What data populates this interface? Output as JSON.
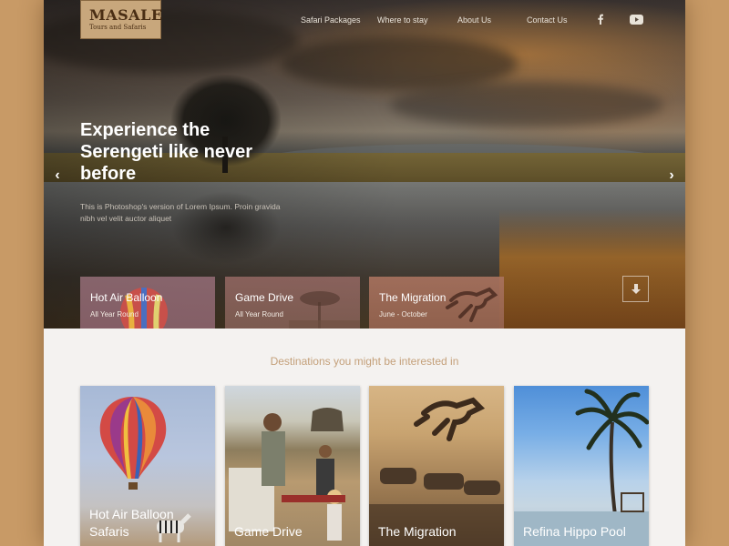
{
  "brand": {
    "name": "MASALE",
    "tagline": "Tours and Safaris"
  },
  "nav": {
    "items": [
      "Safari Packages",
      "Where to stay",
      "About Us",
      "Contact Us"
    ],
    "social": [
      "facebook-icon",
      "youtube-icon"
    ]
  },
  "hero": {
    "title": "Experience the Serengeti like never before",
    "subtitle": "This is Photoshop's version  of Lorem Ipsum. Proin gravida nibh vel velit auctor aliquet",
    "prev": "‹",
    "next": "›"
  },
  "featured": [
    {
      "title": "Hot Air Balloon",
      "subtitle": "All Year Round"
    },
    {
      "title": "Game Drive",
      "subtitle": "All Year Round"
    },
    {
      "title": "The Migration",
      "subtitle": "June - October"
    }
  ],
  "destinations": {
    "heading": "Destinations you might be interested in",
    "cards": [
      {
        "title_line1": "Hot Air Balloon",
        "title_line2": "Safaris"
      },
      {
        "title_line1": "Game Drive",
        "title_line2": ""
      },
      {
        "title_line1": "The Migration",
        "title_line2": ""
      },
      {
        "title_line1": "Refina Hippo Pool",
        "title_line2": ""
      }
    ]
  },
  "colors": {
    "page_bg": "#c89a66",
    "accent": "#c4a07a",
    "logo_bg": "#c8a77c",
    "logo_text": "#4a2e14"
  }
}
